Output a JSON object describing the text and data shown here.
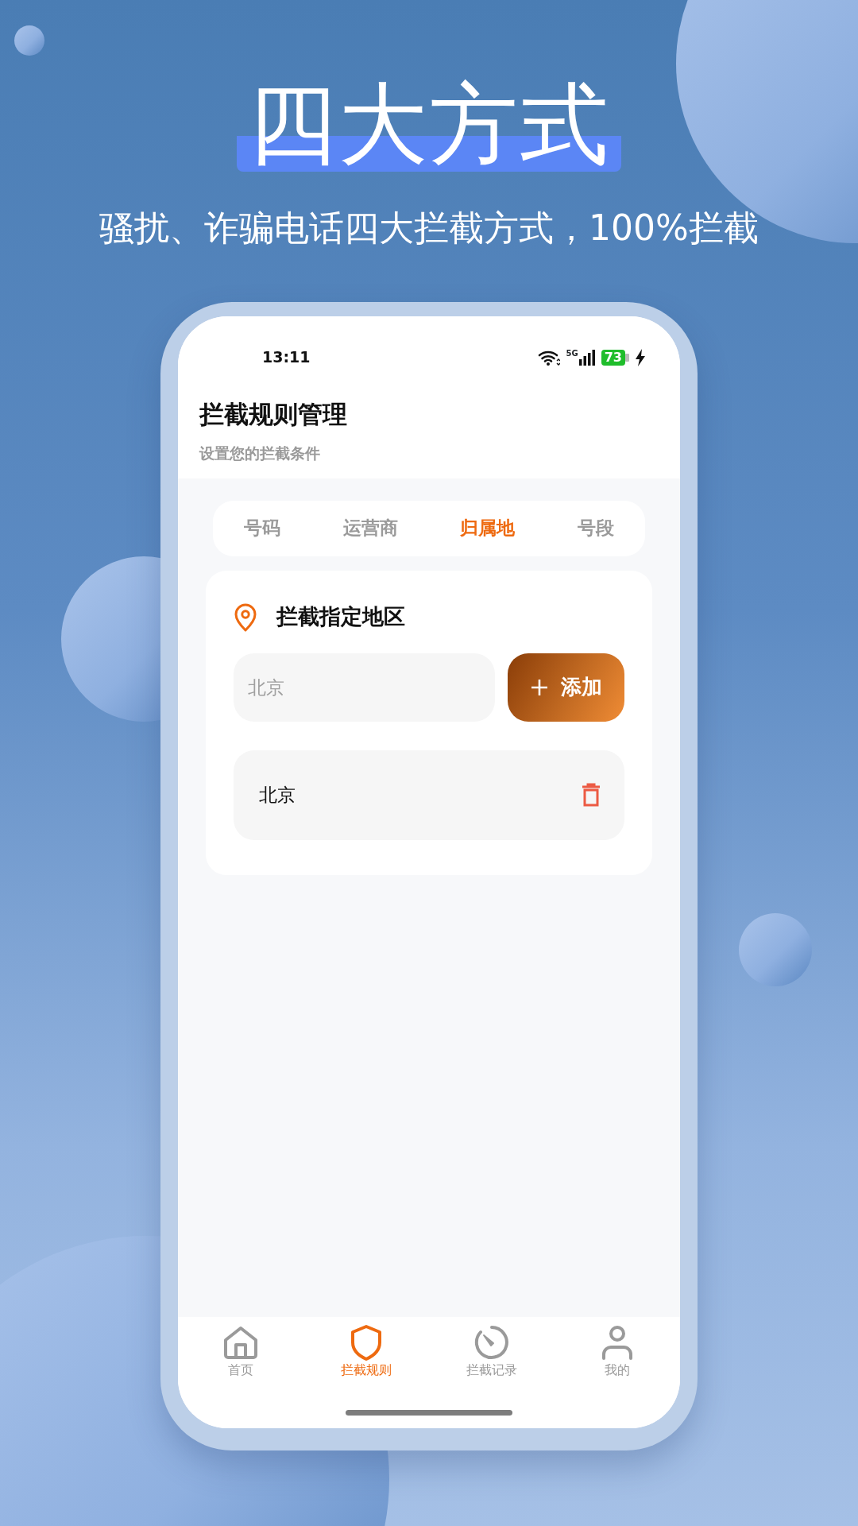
{
  "promo": {
    "headline": "四大方式",
    "subtitle": "骚扰、诈骗电话四大拦截方式，100%拦截"
  },
  "status_bar": {
    "time": "13:11",
    "network": "5G",
    "battery": "73"
  },
  "header": {
    "title": "拦截规则管理",
    "subtitle": "设置您的拦截条件"
  },
  "tabs": [
    {
      "label": "号码",
      "selected": false
    },
    {
      "label": "运营商",
      "selected": false
    },
    {
      "label": "归属地",
      "selected": true
    },
    {
      "label": "号段",
      "selected": false
    }
  ],
  "region_card": {
    "title": "拦截指定地区",
    "input": {
      "placeholder": "北京"
    },
    "add_button": "添加",
    "items": [
      {
        "name": "北京"
      }
    ]
  },
  "bottom_nav": [
    {
      "label": "首页",
      "kind": "home",
      "selected": false
    },
    {
      "label": "拦截规则",
      "kind": "shield",
      "selected": true
    },
    {
      "label": "拦截记录",
      "kind": "timer",
      "selected": false
    },
    {
      "label": "我的",
      "kind": "person",
      "selected": false
    }
  ]
}
